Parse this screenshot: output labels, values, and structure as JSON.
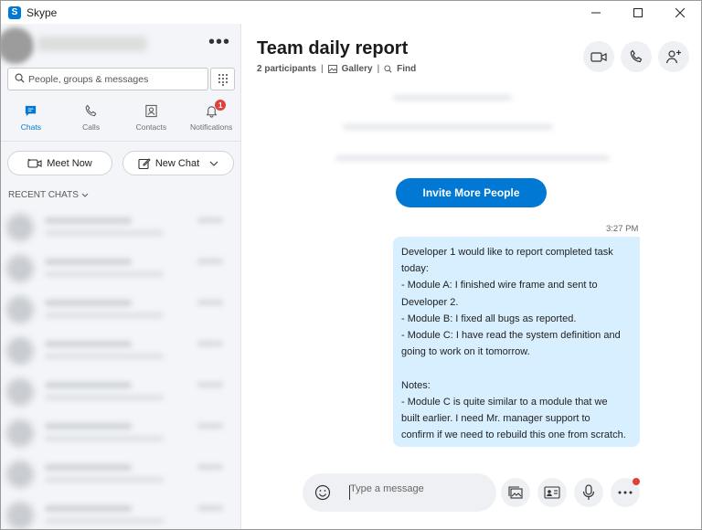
{
  "window": {
    "app_title": "Skype",
    "logo_letter": "S",
    "minimize": "—",
    "maximize": "☐",
    "close": "✕"
  },
  "sidebar": {
    "more_label": "•••",
    "search": {
      "placeholder": "People, groups & messages"
    },
    "tabs": [
      {
        "label": "Chats",
        "icon": "chat-icon",
        "active": true
      },
      {
        "label": "Calls",
        "icon": "phone-icon",
        "active": false
      },
      {
        "label": "Contacts",
        "icon": "contacts-icon",
        "active": false
      },
      {
        "label": "Notifications",
        "icon": "bell-icon",
        "active": false,
        "badge": "1"
      }
    ],
    "meet_now": "Meet Now",
    "new_chat": "New Chat",
    "recent_chats": "RECENT CHATS"
  },
  "conversation": {
    "title": "Team daily report",
    "participants": "2 participants",
    "gallery": "Gallery",
    "find": "Find",
    "invite_button": "Invite More People",
    "message": {
      "time": "3:27 PM",
      "lines": [
        "Developer 1 would like to report completed task",
        "today:",
        "- Module A: I finished wire frame and sent to",
        "Developer 2.",
        "- Module B: I fixed all bugs as reported.",
        "- Module C: I have read the system definition and",
        "going to work on it tomorrow.",
        "",
        "Notes:",
        "- Module C is quite similar to a module that we",
        "built earlier. I need Mr. manager support to",
        "confirm if we need to rebuild this one from scratch."
      ]
    },
    "composer": {
      "placeholder": "Type a message"
    }
  },
  "colors": {
    "accent": "#0078d4",
    "bubble": "#d8efff",
    "badge": "#e0413a"
  }
}
